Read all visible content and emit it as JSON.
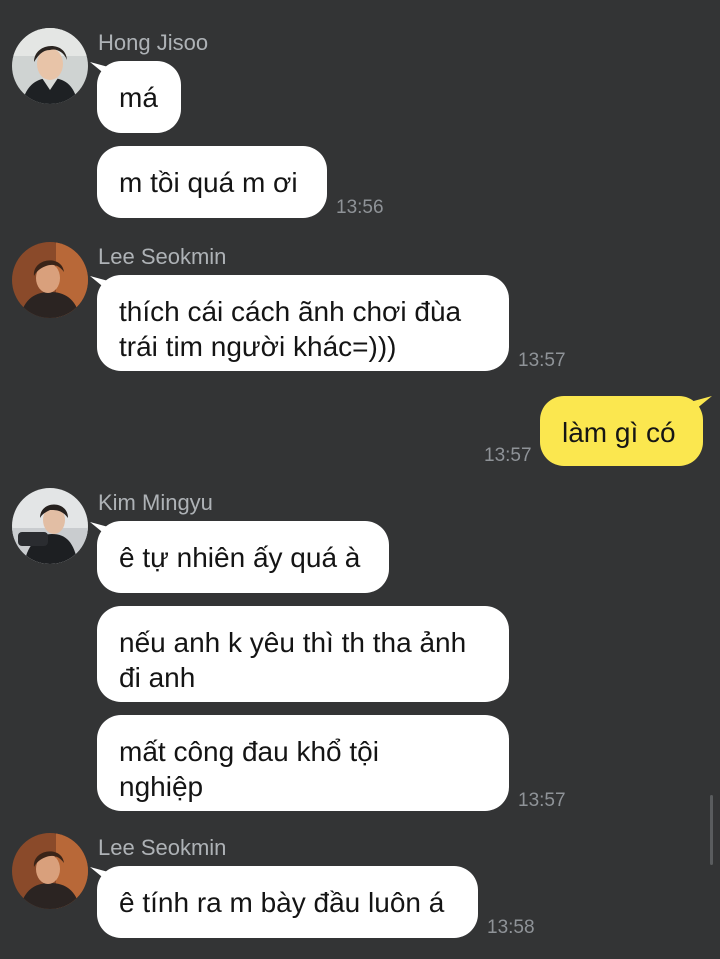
{
  "messages": [
    {
      "sender": "Hong Jisoo",
      "text": "má"
    },
    {
      "text": "m tồi quá m ơi",
      "time": "13:56"
    },
    {
      "sender": "Lee Seokmin",
      "text": "thích cái cách ãnh chơi đùa\ntrái tim người khác=)))",
      "time": "13:57"
    },
    {
      "mine": true,
      "text": "làm gì có",
      "time": "13:57"
    },
    {
      "sender": "Kim Mingyu",
      "text": "ê tự nhiên ấy quá à"
    },
    {
      "text": "nếu anh k yêu thì th tha ảnh\nđi anh"
    },
    {
      "text": "mất công đau khổ tội\nnghiệp",
      "time": "13:57"
    },
    {
      "sender": "Lee Seokmin",
      "text": "ê tính ra m bày đầu luôn á",
      "time": "13:58"
    }
  ],
  "avatars": {
    "hong_jisoo": "profile-photo",
    "lee_seokmin": "profile-photo",
    "kim_mingyu": "profile-photo"
  },
  "colors": {
    "background": "#333435",
    "bubble_incoming": "#ffffff",
    "bubble_outgoing": "#fbe74f",
    "sender_name": "#aeb2b6",
    "timestamp": "#8f9398"
  }
}
